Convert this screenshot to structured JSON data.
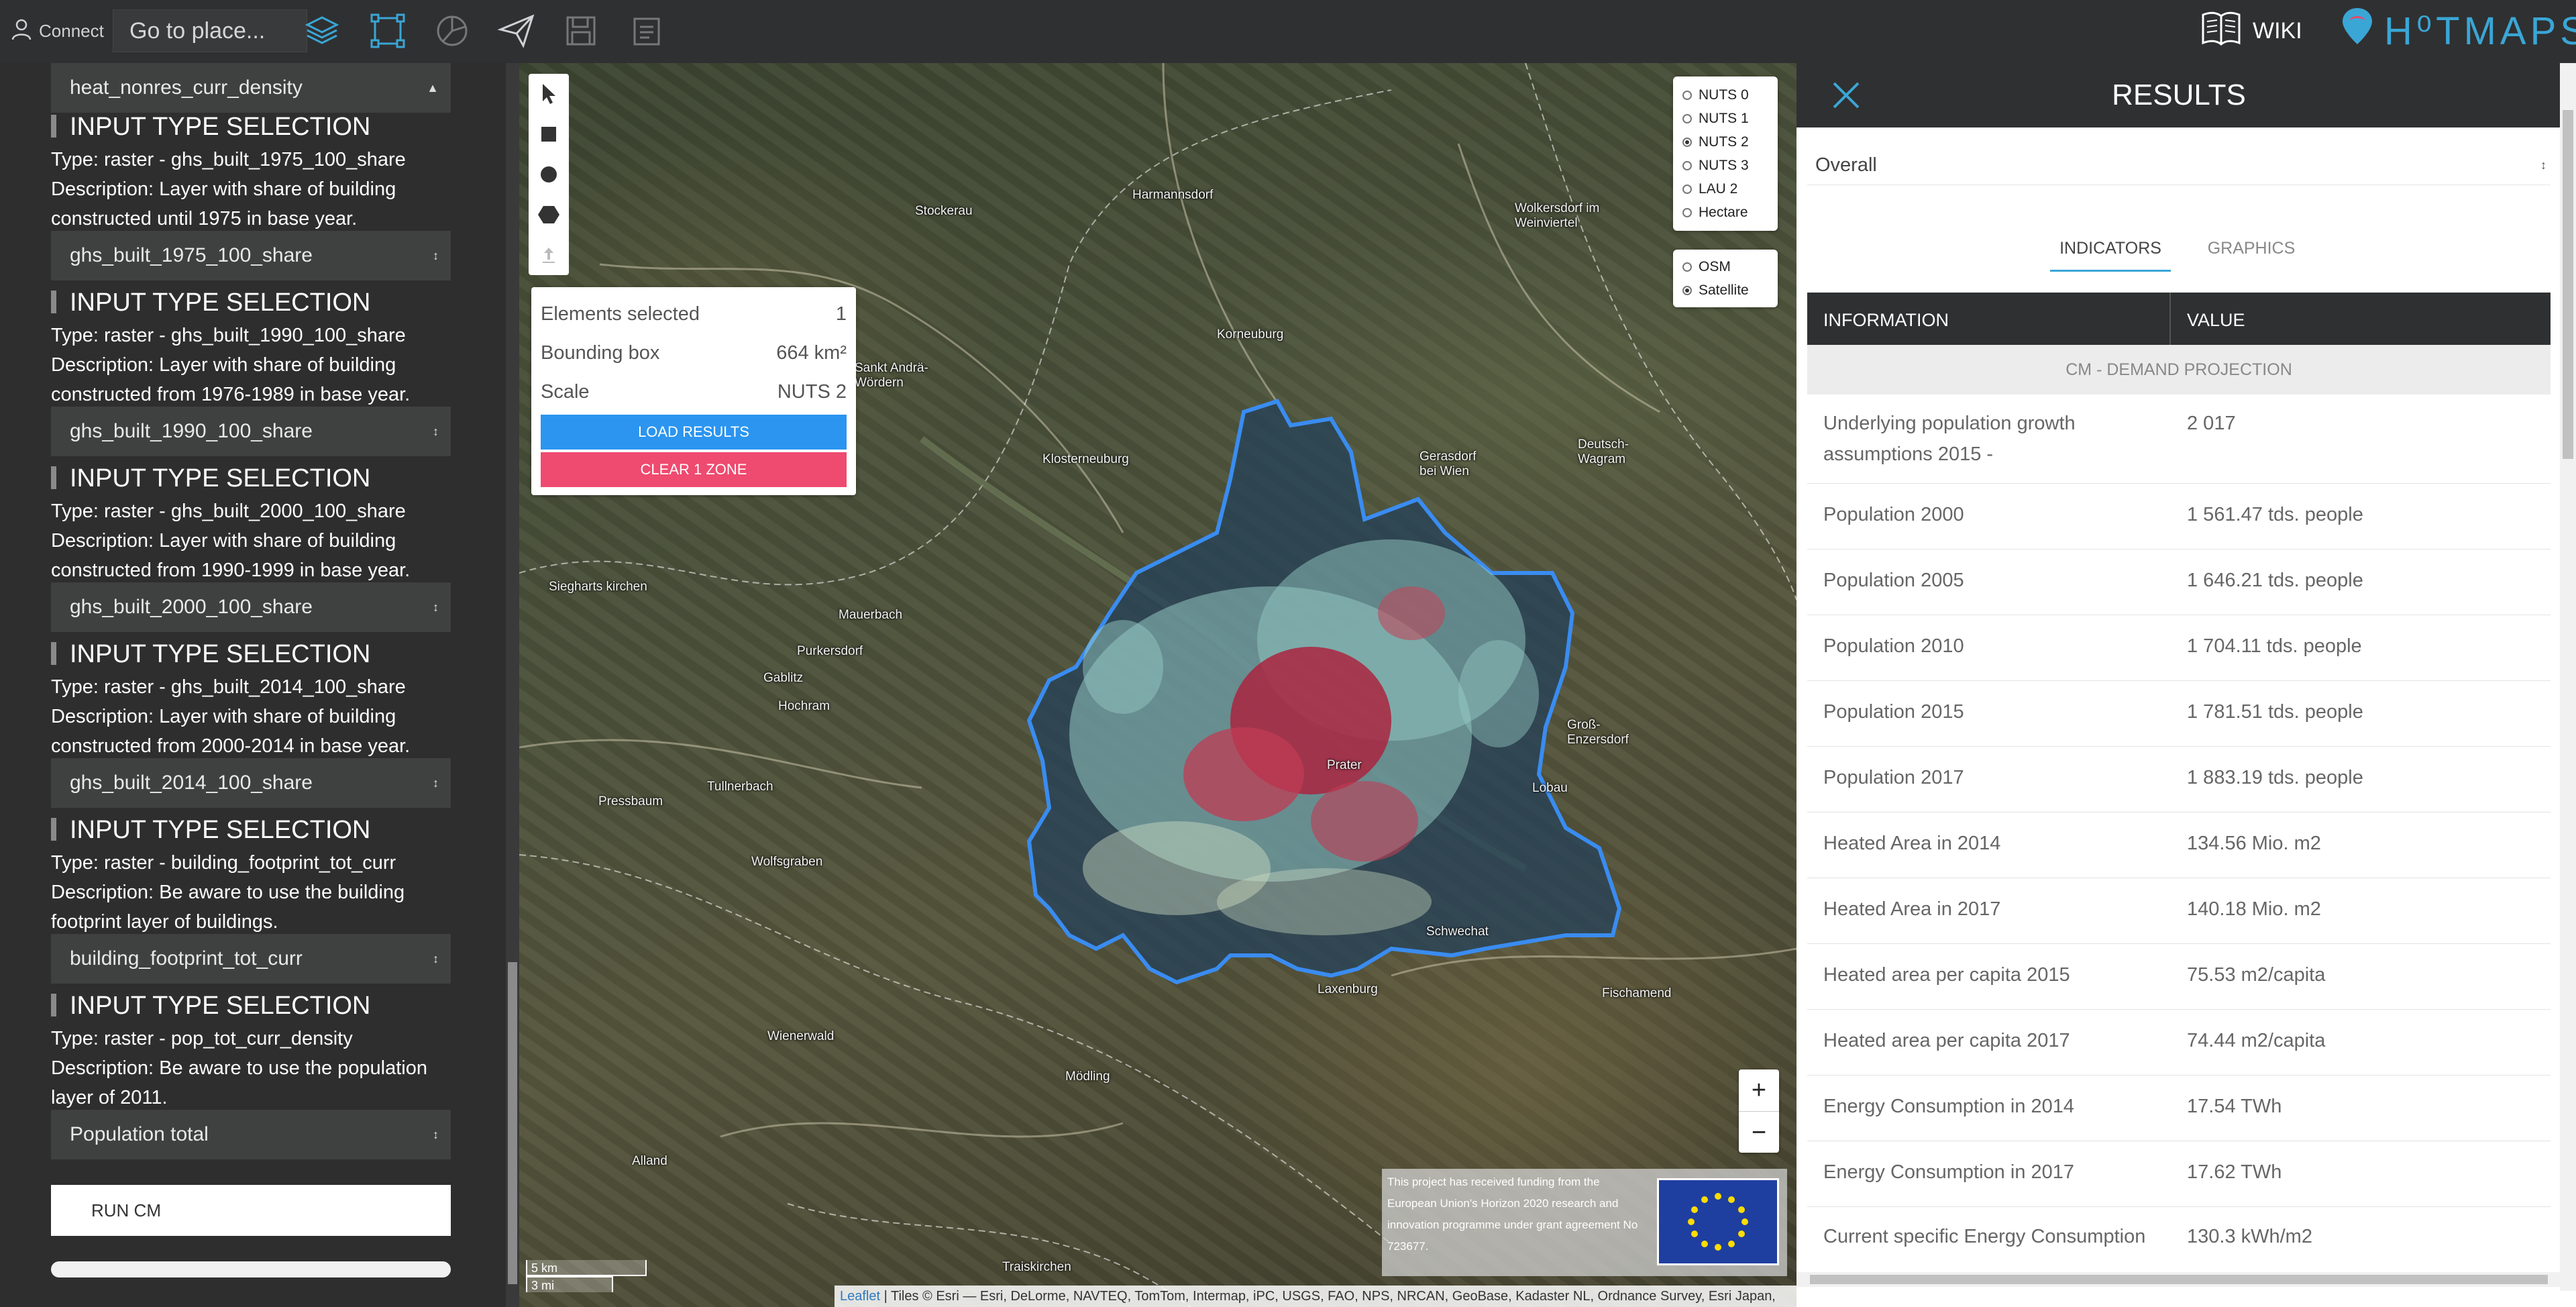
{
  "topbar": {
    "connect_label": "Connect",
    "search_placeholder": "Go to place...",
    "tools": [
      "layers-icon",
      "selection-icon",
      "charts-icon",
      "send-icon",
      "save-icon",
      "files-icon"
    ],
    "wiki_label": "WIKI",
    "brand": "H⁰TMAPS"
  },
  "left_panel": {
    "top_select_value": "heat_nonres_curr_density",
    "group_title": "INPUT TYPE SELECTION",
    "groups": [
      {
        "type": "Type: raster - ghs_built_1975_100_share",
        "description": "Description: Layer with share of building constructed until 1975 in base year.",
        "select_value": "ghs_built_1975_100_share"
      },
      {
        "type": "Type: raster - ghs_built_1990_100_share",
        "description": "Description: Layer with share of building constructed from 1976-1989 in base year.",
        "select_value": "ghs_built_1990_100_share"
      },
      {
        "type": "Type: raster - ghs_built_2000_100_share",
        "description": "Description: Layer with share of building constructed from 1990-1999 in base year.",
        "select_value": "ghs_built_2000_100_share"
      },
      {
        "type": "Type: raster - ghs_built_2014_100_share",
        "description": "Description: Layer with share of building constructed from 2000-2014 in base year.",
        "select_value": "ghs_built_2014_100_share"
      },
      {
        "type": "Type: raster - building_footprint_tot_curr",
        "description": "Description: Be aware to use the building footprint layer of buildings.",
        "select_value": "building_footprint_tot_curr"
      },
      {
        "type": "Type: raster - pop_tot_curr_density",
        "description": "Description: Be aware to use the population layer of 2011.",
        "select_value": "Population total"
      }
    ],
    "run_label": "RUN CM"
  },
  "map": {
    "selection_box": {
      "rows": [
        {
          "label": "Elements selected",
          "value": "1"
        },
        {
          "label": "Bounding box",
          "value": "664 km²"
        },
        {
          "label": "Scale",
          "value": "NUTS 2"
        }
      ],
      "load_label": "LOAD RESULTS",
      "clear_label": "CLEAR 1 ZONE"
    },
    "layers": [
      {
        "label": "NUTS 0",
        "checked": false
      },
      {
        "label": "NUTS 1",
        "checked": false
      },
      {
        "label": "NUTS 2",
        "checked": true
      },
      {
        "label": "NUTS 3",
        "checked": false
      },
      {
        "label": "LAU 2",
        "checked": false
      },
      {
        "label": "Hectare",
        "checked": false
      }
    ],
    "basemaps": [
      {
        "label": "OSM",
        "checked": false
      },
      {
        "label": "Satellite",
        "checked": true
      }
    ],
    "zoom_in": "+",
    "zoom_out": "−",
    "eu_notice": "This project has received funding from the European Union's Horizon 2020 research and innovation programme under grant agreement No 723677.",
    "scale_km": "5 km",
    "scale_mi": "3 mi",
    "attribution_link": "Leaflet",
    "attribution_text": " | Tiles © Esri — Esri, DeLorme, NAVTEQ, TomTom, Intermap, iPC, USGS, FAO, NPS, NRCAN, GeoBase, Kadaster NL, Ordnance Survey, Esri Japan,",
    "places": [
      "Stockerau",
      "Korneuburg",
      "Klosterneuburg",
      "Gerasdorf bei Wien",
      "Deutsch-Wagram",
      "Schwechat",
      "Mödling",
      "Purkersdorf",
      "Gablitz",
      "Pressbaum",
      "Wolfsgraben",
      "Tullnerbach",
      "Fischamend",
      "Wienerwald",
      "Laxenburg",
      "Mauerbach",
      "Siegharts kirchen",
      "Harmannsdorf",
      "Wolkersdorf im Weinviertel",
      "Groß-Enzersdorf",
      "Lobau",
      "Prater",
      "Alland",
      "Traiskirchen",
      "Hochram",
      "Sankt Andrä-Wördern"
    ]
  },
  "results": {
    "title": "RESULTS",
    "select_value": "Overall",
    "tabs": [
      "INDICATORS",
      "GRAPHICS"
    ],
    "columns": [
      "INFORMATION",
      "VALUE"
    ],
    "section": "CM - DEMAND PROJECTION",
    "rows": [
      {
        "label": "Underlying population growth assumptions 2015 -",
        "value": "2 017"
      },
      {
        "label": "Population 2000",
        "value": "1 561.47 tds. people"
      },
      {
        "label": "Population 2005",
        "value": "1 646.21 tds. people"
      },
      {
        "label": "Population 2010",
        "value": "1 704.11 tds. people"
      },
      {
        "label": "Population 2015",
        "value": "1 781.51 tds. people"
      },
      {
        "label": "Population 2017",
        "value": "1 883.19 tds. people"
      },
      {
        "label": "Heated Area in 2014",
        "value": "134.56 Mio. m2"
      },
      {
        "label": "Heated Area in 2017",
        "value": "140.18 Mio. m2"
      },
      {
        "label": "Heated area per capita 2015",
        "value": "75.53 m2/capita"
      },
      {
        "label": "Heated area per capita 2017",
        "value": "74.44 m2/capita"
      },
      {
        "label": "Energy Consumption in 2014",
        "value": "17.54 TWh"
      },
      {
        "label": "Energy Consumption in 2017",
        "value": "17.62 TWh"
      },
      {
        "label": "Current specific Energy Consumption",
        "value": "130.3 kWh/m2"
      }
    ]
  }
}
